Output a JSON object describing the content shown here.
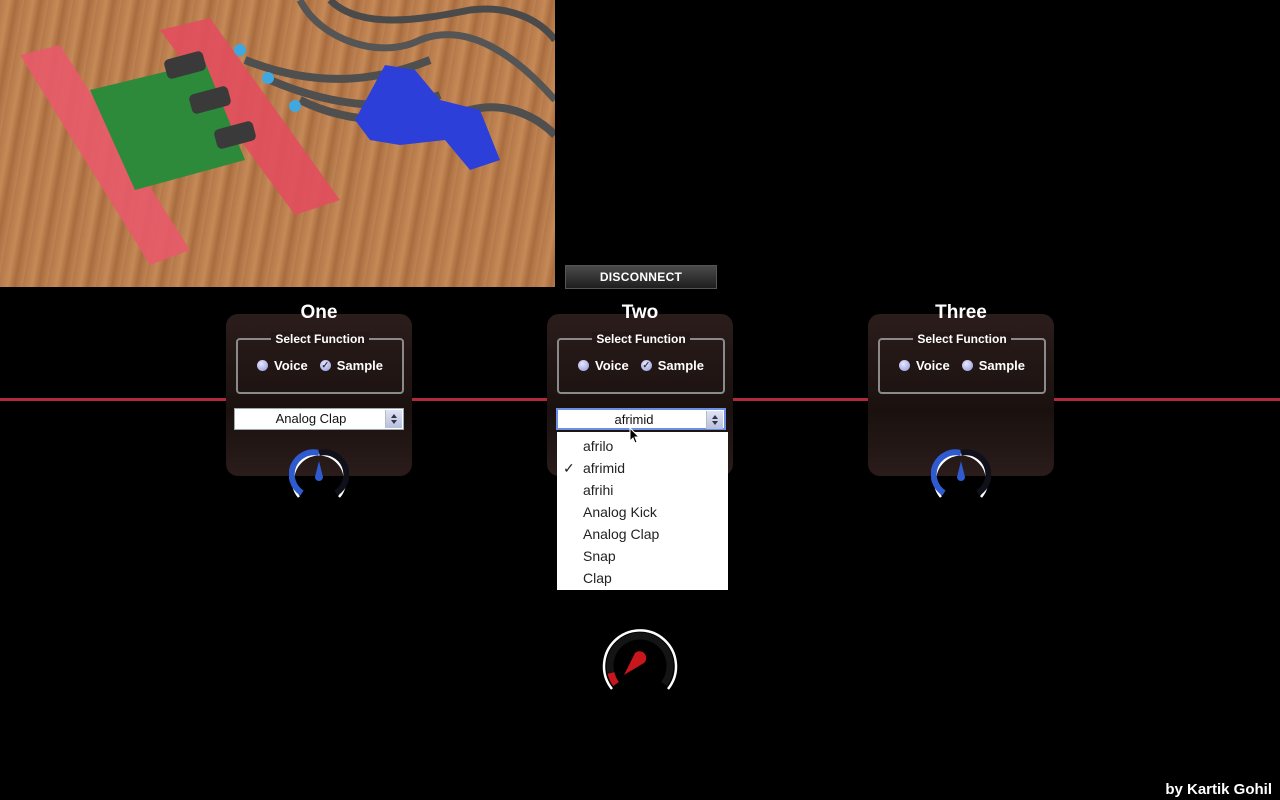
{
  "buttons": {
    "disconnect": "DISCONNECT"
  },
  "fieldset_legend": "Select Function",
  "channels": [
    {
      "title": "One",
      "voice_label": "Voice",
      "sample_label": "Sample",
      "selected_function": "Sample",
      "selected_sound": "Analog Clap",
      "knob_color": "#2f5bd0"
    },
    {
      "title": "Two",
      "voice_label": "Voice",
      "sample_label": "Sample",
      "selected_function": "Sample",
      "selected_sound": "afrimid",
      "knob_color": "#2f5bd0"
    },
    {
      "title": "Three",
      "voice_label": "Voice",
      "sample_label": "Sample",
      "selected_function": "",
      "selected_sound": "",
      "knob_color": "#2f5bd0"
    }
  ],
  "dropdown": {
    "options": [
      "afrilo",
      "afrimid",
      "afrihi",
      "Analog Kick",
      "Analog Clap",
      "Snap",
      "Clap"
    ],
    "checked": "afrimid"
  },
  "master_knob_color": "#c8161d",
  "divider_color": "#b02a3a",
  "footer": {
    "credit": "by Kartik Gohil"
  }
}
